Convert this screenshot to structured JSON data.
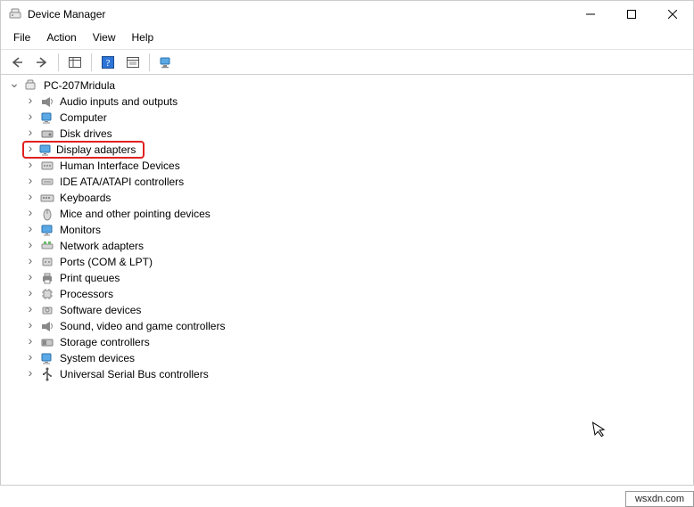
{
  "window": {
    "title": "Device Manager"
  },
  "menubar": {
    "file": "File",
    "action": "Action",
    "view": "View",
    "help": "Help"
  },
  "tree": {
    "root": "PC-207Mridula",
    "items": [
      "Audio inputs and outputs",
      "Computer",
      "Disk drives",
      "Display adapters",
      "Human Interface Devices",
      "IDE ATA/ATAPI controllers",
      "Keyboards",
      "Mice and other pointing devices",
      "Monitors",
      "Network adapters",
      "Ports (COM & LPT)",
      "Print queues",
      "Processors",
      "Software devices",
      "Sound, video and game controllers",
      "Storage controllers",
      "System devices",
      "Universal Serial Bus controllers"
    ],
    "highlighted_index": 3
  },
  "watermark": "wsxdn.com"
}
